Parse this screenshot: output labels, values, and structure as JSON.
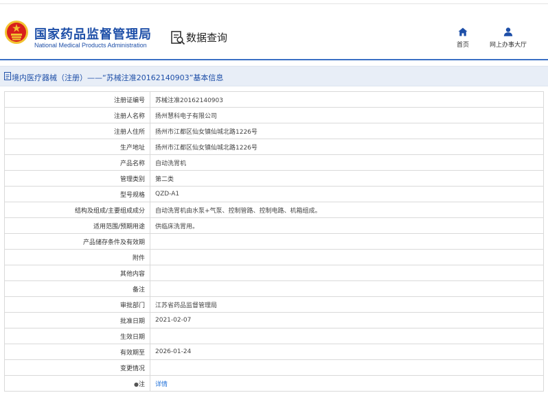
{
  "header": {
    "title_cn": "国家药品监督管理局",
    "title_en": "National Medical Products Administration",
    "query_label": "数据查询",
    "nav": {
      "home": "首页",
      "office": "网上办事大厅"
    }
  },
  "title_bar": {
    "text": "境内医疗器械（注册）——“苏械注准20162140903”基本信息"
  },
  "rows": [
    {
      "label": "注册证编号",
      "value": "苏械注准20162140903"
    },
    {
      "label": "注册人名称",
      "value": "扬州慧科电子有限公司"
    },
    {
      "label": "注册人住所",
      "value": "扬州市江都区仙女镇仙城北路1226号"
    },
    {
      "label": "生产地址",
      "value": "扬州市江都区仙女镇仙城北路1226号"
    },
    {
      "label": "产品名称",
      "value": "自动洗胃机"
    },
    {
      "label": "管理类别",
      "value": "第二类"
    },
    {
      "label": "型号规格",
      "value": "QZD-A1"
    },
    {
      "label": "结构及组成/主要组成成分",
      "value": "自动洗胃机由水泵+气泵、控制管路、控制电路、机箱组成。"
    },
    {
      "label": "适用范围/预期用途",
      "value": "供临床洗胃用。"
    },
    {
      "label": "产品储存条件及有效期",
      "value": ""
    },
    {
      "label": "附件",
      "value": ""
    },
    {
      "label": "其他内容",
      "value": ""
    },
    {
      "label": "备注",
      "value": ""
    },
    {
      "label": "审批部门",
      "value": "江苏省药品监督管理局"
    },
    {
      "label": "批准日期",
      "value": "2021-02-07"
    },
    {
      "label": "生效日期",
      "value": ""
    },
    {
      "label": "有效期至",
      "value": "2026-01-24"
    },
    {
      "label": "变更情况",
      "value": ""
    },
    {
      "label": "注",
      "value": "详情"
    }
  ],
  "colors": {
    "brand_blue": "#1e4fa8",
    "title_bar_bg": "#e8eef7",
    "link": "#1e6fd8",
    "emblem_red": "#d8201c",
    "emblem_gold": "#f2c230"
  }
}
